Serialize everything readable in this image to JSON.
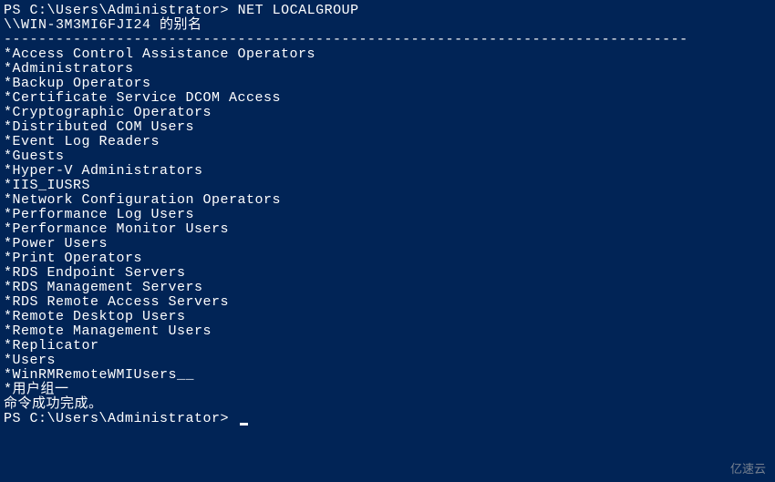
{
  "prompt": "PS C:\\Users\\Administrator>",
  "command": "NET LOCALGROUP",
  "blank": "",
  "hostline": "\\\\WIN-3M3MI6FJI24 的别名",
  "separator": "-------------------------------------------------------------------------------",
  "groups": [
    "*Access Control Assistance Operators",
    "*Administrators",
    "*Backup Operators",
    "*Certificate Service DCOM Access",
    "*Cryptographic Operators",
    "*Distributed COM Users",
    "*Event Log Readers",
    "*Guests",
    "*Hyper-V Administrators",
    "*IIS_IUSRS",
    "*Network Configuration Operators",
    "*Performance Log Users",
    "*Performance Monitor Users",
    "*Power Users",
    "*Print Operators",
    "*RDS Endpoint Servers",
    "*RDS Management Servers",
    "*RDS Remote Access Servers",
    "*Remote Desktop Users",
    "*Remote Management Users",
    "*Replicator",
    "*Users",
    "*WinRMRemoteWMIUsers__",
    "*用户组一"
  ],
  "success": "命令成功完成。",
  "watermark": "亿速云"
}
